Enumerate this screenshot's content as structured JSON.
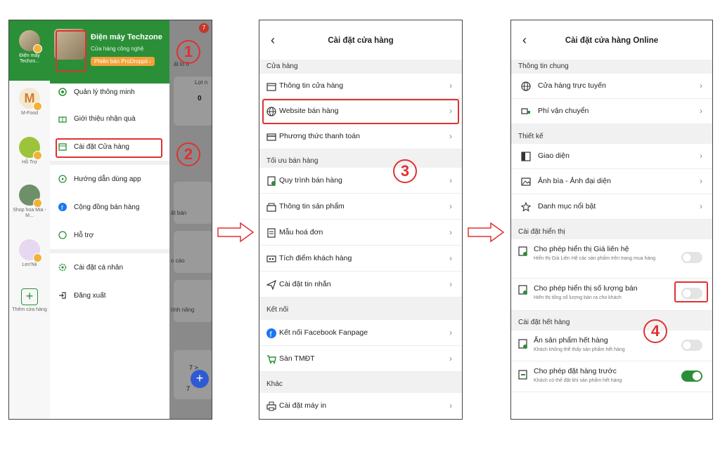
{
  "panel1": {
    "stores": [
      {
        "name": "Điện máy Techzo..."
      },
      {
        "name": "M-Food"
      },
      {
        "name": "Hỗ Trợ"
      },
      {
        "name": "Shop hoa Mia - M..."
      },
      {
        "name": "Len'Nii"
      },
      {
        "name": "Thêm cửa hàng"
      }
    ],
    "drawer": {
      "store_name": "Điện máy Techzone",
      "store_sub": "Cửa hàng công nghệ",
      "version_pill": "Phiên bản ProDroppii ›",
      "menu": [
        "Quản lý thông minh",
        "Giới thiệu nhận quà",
        "Cài đặt Cửa hàng",
        "Hướng dẫn dùng app",
        "Cộng đồng bán hàng",
        "Hỗ trợ",
        "Cài đặt cá nhân",
        "Đăng xuất"
      ]
    },
    "bg_fragments": [
      "ất lỗ 6",
      "Lợi n",
      "0",
      "ất bán",
      "o cáo",
      "tính năng",
      "7 >",
      "7"
    ],
    "notif_count": "7"
  },
  "panel2": {
    "title": "Cài đặt cửa hàng",
    "sections": [
      {
        "label": "Cửa hàng",
        "items": [
          "Thông tin cửa hàng",
          "Website bán hàng",
          "Phương thức thanh toán"
        ]
      },
      {
        "label": "Tối ưu bán hàng",
        "items": [
          "Quy trình bán hàng",
          "Thông tin sản phẩm",
          "Mẫu hoá đơn",
          "Tích điểm khách hàng",
          "Cài đặt tin nhắn"
        ]
      },
      {
        "label": "Kết nối",
        "items": [
          "Kết nối Facebook Fanpage",
          "Sàn TMĐT"
        ]
      },
      {
        "label": "Khác",
        "items": [
          "Cài đặt máy in"
        ]
      }
    ]
  },
  "panel3": {
    "title": "Cài đặt cửa hàng Online",
    "sections": [
      {
        "label": "Thông tin chung",
        "items": [
          "Cửa hàng trực tuyến",
          "Phí vận chuyển"
        ]
      },
      {
        "label": "Thiết kế",
        "items": [
          "Giao diện",
          "Ảnh bìa - Ảnh đại diện",
          "Danh mục nổi bật"
        ]
      },
      {
        "label": "Cài đặt hiển thị"
      },
      {
        "label": "Cài đặt hết hàng"
      }
    ],
    "toggles": [
      {
        "title": "Cho phép hiển thị Giá liên hệ",
        "desc": "Hiển thị Giá Liên Hệ các sản phẩm trên trang mua hàng",
        "on": false
      },
      {
        "title": "Cho phép hiển thị số lượng bán",
        "desc": "Hiển thị tổng số lượng bán ra cho khách",
        "on": false
      },
      {
        "title": "Ẩn sản phẩm hết hàng",
        "desc": "Khách không thể thấy sản phẩm hết hàng",
        "on": false
      },
      {
        "title": "Cho phép đặt hàng trước",
        "desc": "Khách có thể đặt khi sản phẩm hết hàng",
        "on": true
      }
    ]
  },
  "steps": [
    "1",
    "2",
    "3",
    "4"
  ],
  "colors": {
    "brand_green": "#2a8f37",
    "highlight_red": "#e03131",
    "pill_orange": "#f2a23a"
  }
}
